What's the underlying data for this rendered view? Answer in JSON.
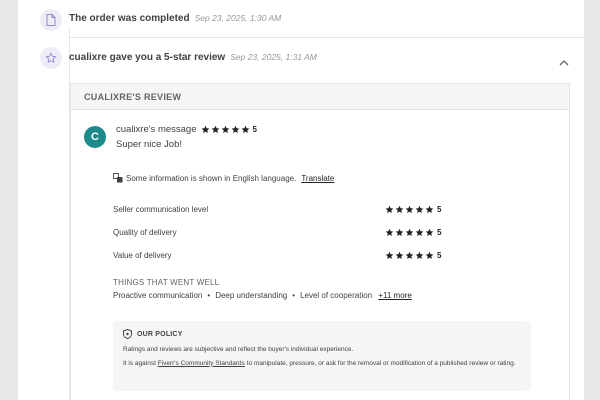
{
  "events": [
    {
      "text": "The order was completed",
      "time": "Sep 23, 2025, 1:30 AM",
      "icon": "document-icon"
    },
    {
      "text": "cualixre gave you a 5-star review",
      "time": "Sep 23, 2025, 1:31 AM",
      "icon": "star-outline-icon"
    }
  ],
  "review": {
    "header": "CUALIXRE'S REVIEW",
    "avatar_letter": "C",
    "avatar_color": "#1f8a8a",
    "message_title": "cualixre's message",
    "overall_rating": "5",
    "message_body": "Super nice Job!",
    "info_text": "Some information is shown in English language.",
    "translate_label": "Translate",
    "ratings": [
      {
        "label": "Seller communication level",
        "value": "5"
      },
      {
        "label": "Quality of delivery",
        "value": "5"
      },
      {
        "label": "Value of delivery",
        "value": "5"
      }
    ],
    "went_well_title": "THINGS THAT WENT WELL",
    "went_well_items": [
      "Proactive communication",
      "Deep understanding",
      "Level of cooperation"
    ],
    "more_label": "+11 more",
    "policy": {
      "title": "OUR POLICY",
      "text1": "Ratings and reviews are subjective and reflect the buyer's individual experience.",
      "text2_before": "It is against",
      "text2_link": "Fiverr's Community Standards",
      "text2_after": "to manipulate, pressure, or ask for the removal or modification of a published review or rating."
    }
  },
  "colors": {
    "star": "#222325",
    "icon_bg": "#eeedf7",
    "icon_stroke": "#8f8ac4"
  }
}
